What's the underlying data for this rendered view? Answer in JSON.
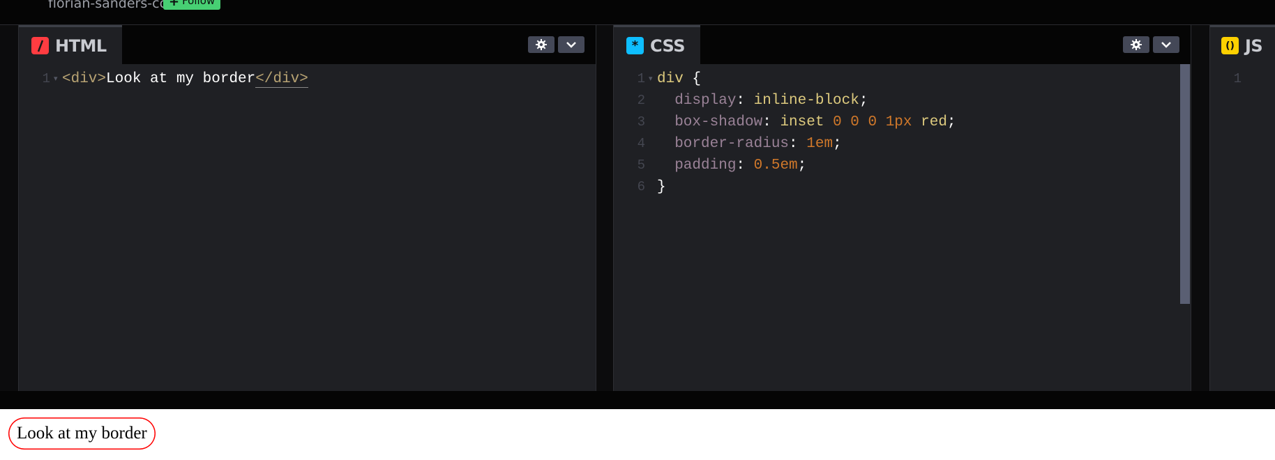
{
  "header": {
    "username": "florian-sanders-cc",
    "follow_label": "Follow",
    "follow_color": "#47cf73"
  },
  "panes": {
    "html": {
      "label": "HTML",
      "icon_glyph": "/",
      "icon_color": "#ff3c41",
      "lines": [
        {
          "num": "1",
          "parts": [
            [
              "tag",
              "<div>"
            ],
            [
              "txt",
              "Look at my border"
            ],
            [
              "tag match",
              "</div>"
            ]
          ],
          "fold": true
        }
      ]
    },
    "css": {
      "label": "CSS",
      "icon_glyph": "*",
      "icon_color": "#0ebeff",
      "lines": [
        {
          "num": "1",
          "parts": [
            [
              "sel",
              "div"
            ],
            [
              "punc",
              " {"
            ]
          ],
          "fold": true
        },
        {
          "num": "2",
          "parts": [
            [
              "prop",
              "  display"
            ],
            [
              "punc",
              ": "
            ],
            [
              "val",
              "inline-block"
            ],
            [
              "punc",
              ";"
            ]
          ]
        },
        {
          "num": "3",
          "parts": [
            [
              "prop",
              "  box-shadow"
            ],
            [
              "punc",
              ": "
            ],
            [
              "val",
              "inset "
            ],
            [
              "num",
              "0 0 0 1px "
            ],
            [
              "val",
              "red"
            ],
            [
              "punc",
              ";"
            ]
          ]
        },
        {
          "num": "4",
          "parts": [
            [
              "prop",
              "  border-radius"
            ],
            [
              "punc",
              ": "
            ],
            [
              "num",
              "1em"
            ],
            [
              "punc",
              ";"
            ]
          ]
        },
        {
          "num": "5",
          "parts": [
            [
              "prop",
              "  padding"
            ],
            [
              "punc",
              ": "
            ],
            [
              "num",
              "0.5em"
            ],
            [
              "punc",
              ";"
            ]
          ]
        },
        {
          "num": "6",
          "parts": [
            [
              "punc",
              "}"
            ]
          ]
        }
      ]
    },
    "js": {
      "label": "JS",
      "icon_glyph": "( )",
      "icon_color": "#fcd000",
      "lines": [
        {
          "num": "1",
          "parts": []
        }
      ]
    }
  },
  "preview": {
    "text": "Look at my border"
  }
}
